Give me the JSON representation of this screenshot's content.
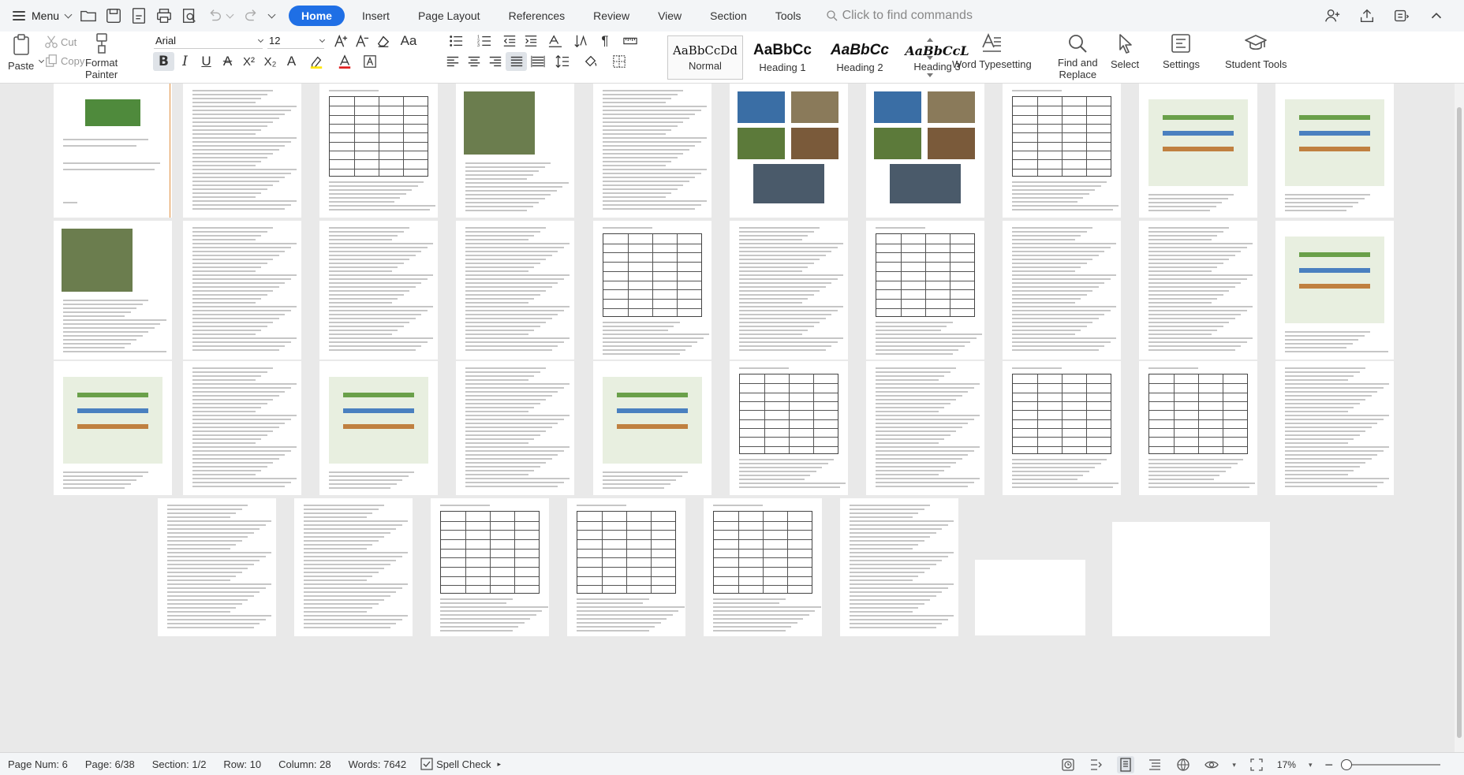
{
  "menubar": {
    "menu_label": "Menu",
    "tabs": [
      {
        "label": "Home",
        "active": true
      },
      {
        "label": "Insert",
        "active": false
      },
      {
        "label": "Page Layout",
        "active": false
      },
      {
        "label": "References",
        "active": false
      },
      {
        "label": "Review",
        "active": false
      },
      {
        "label": "View",
        "active": false
      },
      {
        "label": "Section",
        "active": false
      },
      {
        "label": "Tools",
        "active": false
      }
    ],
    "search_placeholder": "Click to find commands",
    "accent_color": "#1f6fe5"
  },
  "ribbon": {
    "paste": "Paste",
    "cut": "Cut",
    "copy": "Copy",
    "format_painter_line1": "Format",
    "format_painter_line2": "Painter",
    "font_name": "Arial",
    "font_size": "12",
    "styles": [
      {
        "sample": "AaBbCcDd",
        "name": "Normal"
      },
      {
        "sample": "AaBbCc",
        "name": "Heading 1"
      },
      {
        "sample": "AaBbCc",
        "name": "Heading 2"
      },
      {
        "sample": "AaBbCcL",
        "name": "Heading 3"
      }
    ],
    "word_typesetting": "Word Typesetting",
    "find_replace_line1": "Find and",
    "find_replace_line2": "Replace",
    "select": "Select",
    "settings": "Settings",
    "student_tools": "Student Tools"
  },
  "status": {
    "page_num": "Page Num: 6",
    "page": "Page: 6/38",
    "section": "Section: 1/2",
    "row": "Row: 10",
    "column": "Column: 28",
    "words": "Words: 7642",
    "spell_check": "Spell Check",
    "zoom": "17%"
  }
}
